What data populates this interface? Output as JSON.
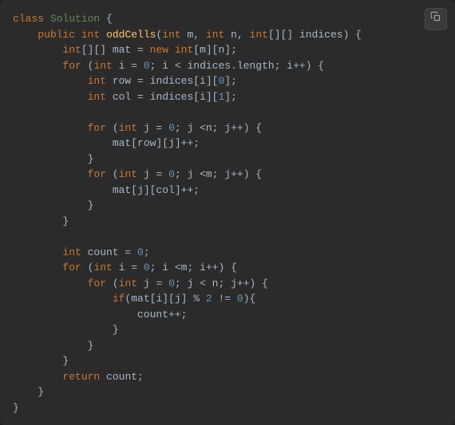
{
  "code": {
    "language": "java",
    "lines": [
      {
        "indent": 0,
        "tokens": [
          {
            "c": "k",
            "t": "class"
          },
          {
            "c": "p",
            "t": " "
          },
          {
            "c": "s",
            "t": "Solution"
          },
          {
            "c": "p",
            "t": " {"
          }
        ]
      },
      {
        "indent": 1,
        "tokens": [
          {
            "c": "k",
            "t": "public"
          },
          {
            "c": "p",
            "t": " "
          },
          {
            "c": "t",
            "t": "int"
          },
          {
            "c": "p",
            "t": " "
          },
          {
            "c": "fn",
            "t": "oddCells"
          },
          {
            "c": "p",
            "t": "("
          },
          {
            "c": "t",
            "t": "int"
          },
          {
            "c": "p",
            "t": " m, "
          },
          {
            "c": "t",
            "t": "int"
          },
          {
            "c": "p",
            "t": " n, "
          },
          {
            "c": "t",
            "t": "int"
          },
          {
            "c": "p",
            "t": "[][] indices) {"
          }
        ]
      },
      {
        "indent": 2,
        "tokens": [
          {
            "c": "t",
            "t": "int"
          },
          {
            "c": "p",
            "t": "[][] mat = "
          },
          {
            "c": "k",
            "t": "new"
          },
          {
            "c": "p",
            "t": " "
          },
          {
            "c": "t",
            "t": "int"
          },
          {
            "c": "p",
            "t": "[m][n];"
          }
        ]
      },
      {
        "indent": 2,
        "tokens": [
          {
            "c": "k",
            "t": "for"
          },
          {
            "c": "p",
            "t": " ("
          },
          {
            "c": "t",
            "t": "int"
          },
          {
            "c": "p",
            "t": " i = "
          },
          {
            "c": "n",
            "t": "0"
          },
          {
            "c": "p",
            "t": "; i < indices.length; i++) {"
          }
        ]
      },
      {
        "indent": 3,
        "tokens": [
          {
            "c": "t",
            "t": "int"
          },
          {
            "c": "p",
            "t": " row = indices[i]["
          },
          {
            "c": "n",
            "t": "0"
          },
          {
            "c": "p",
            "t": "];"
          }
        ]
      },
      {
        "indent": 3,
        "tokens": [
          {
            "c": "t",
            "t": "int"
          },
          {
            "c": "p",
            "t": " col = indices[i]["
          },
          {
            "c": "n",
            "t": "1"
          },
          {
            "c": "p",
            "t": "];"
          }
        ]
      },
      {
        "indent": 0,
        "tokens": []
      },
      {
        "indent": 3,
        "tokens": [
          {
            "c": "k",
            "t": "for"
          },
          {
            "c": "p",
            "t": " ("
          },
          {
            "c": "t",
            "t": "int"
          },
          {
            "c": "p",
            "t": " j = "
          },
          {
            "c": "n",
            "t": "0"
          },
          {
            "c": "p",
            "t": "; j <n; j++) {"
          }
        ]
      },
      {
        "indent": 4,
        "tokens": [
          {
            "c": "p",
            "t": "mat[row][j]++;"
          }
        ]
      },
      {
        "indent": 3,
        "tokens": [
          {
            "c": "p",
            "t": "}"
          }
        ]
      },
      {
        "indent": 3,
        "tokens": [
          {
            "c": "k",
            "t": "for"
          },
          {
            "c": "p",
            "t": " ("
          },
          {
            "c": "t",
            "t": "int"
          },
          {
            "c": "p",
            "t": " j = "
          },
          {
            "c": "n",
            "t": "0"
          },
          {
            "c": "p",
            "t": "; j <m; j++) {"
          }
        ]
      },
      {
        "indent": 4,
        "tokens": [
          {
            "c": "p",
            "t": "mat[j][col]++;"
          }
        ]
      },
      {
        "indent": 3,
        "tokens": [
          {
            "c": "p",
            "t": "}"
          }
        ]
      },
      {
        "indent": 2,
        "tokens": [
          {
            "c": "p",
            "t": "}"
          }
        ]
      },
      {
        "indent": 0,
        "tokens": []
      },
      {
        "indent": 2,
        "tokens": [
          {
            "c": "t",
            "t": "int"
          },
          {
            "c": "p",
            "t": " count = "
          },
          {
            "c": "n",
            "t": "0"
          },
          {
            "c": "p",
            "t": ";"
          }
        ]
      },
      {
        "indent": 2,
        "tokens": [
          {
            "c": "k",
            "t": "for"
          },
          {
            "c": "p",
            "t": " ("
          },
          {
            "c": "t",
            "t": "int"
          },
          {
            "c": "p",
            "t": " i = "
          },
          {
            "c": "n",
            "t": "0"
          },
          {
            "c": "p",
            "t": "; i <m; i++) {"
          }
        ]
      },
      {
        "indent": 3,
        "tokens": [
          {
            "c": "k",
            "t": "for"
          },
          {
            "c": "p",
            "t": " ("
          },
          {
            "c": "t",
            "t": "int"
          },
          {
            "c": "p",
            "t": " j = "
          },
          {
            "c": "n",
            "t": "0"
          },
          {
            "c": "p",
            "t": "; j < n; j++) {"
          }
        ]
      },
      {
        "indent": 4,
        "tokens": [
          {
            "c": "k",
            "t": "if"
          },
          {
            "c": "p",
            "t": "(mat[i][j] % "
          },
          {
            "c": "n",
            "t": "2"
          },
          {
            "c": "p",
            "t": " != "
          },
          {
            "c": "n",
            "t": "0"
          },
          {
            "c": "p",
            "t": "){"
          }
        ]
      },
      {
        "indent": 5,
        "tokens": [
          {
            "c": "p",
            "t": "count++;"
          }
        ]
      },
      {
        "indent": 4,
        "tokens": [
          {
            "c": "p",
            "t": "}"
          }
        ]
      },
      {
        "indent": 3,
        "tokens": [
          {
            "c": "p",
            "t": "}"
          }
        ]
      },
      {
        "indent": 2,
        "tokens": [
          {
            "c": "p",
            "t": "}"
          }
        ]
      },
      {
        "indent": 2,
        "tokens": [
          {
            "c": "k",
            "t": "return"
          },
          {
            "c": "p",
            "t": " count;"
          }
        ]
      },
      {
        "indent": 1,
        "tokens": [
          {
            "c": "p",
            "t": "}"
          }
        ]
      },
      {
        "indent": 0,
        "tokens": [
          {
            "c": "p",
            "t": "}"
          }
        ]
      }
    ]
  },
  "ui": {
    "copy_tooltip": "Copy"
  }
}
